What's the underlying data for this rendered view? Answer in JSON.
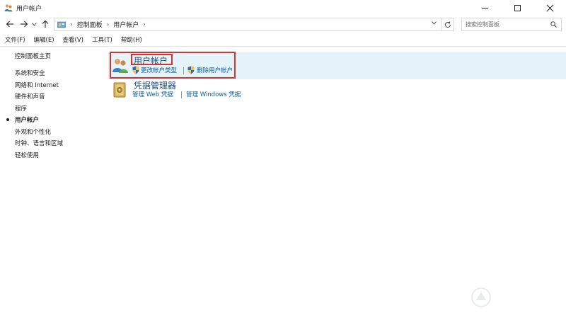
{
  "window": {
    "title": "用户帐户",
    "icon": "users-icon"
  },
  "address": {
    "crumbs": [
      "控制面板",
      "用户帐户"
    ],
    "search_placeholder": "搜索控制面板"
  },
  "menu": {
    "items": [
      "文件(F)",
      "编辑(E)",
      "查看(V)",
      "工具(T)",
      "帮助(H)"
    ]
  },
  "sidebar": {
    "home": "控制面板主页",
    "items": [
      {
        "label": "系统和安全",
        "active": false
      },
      {
        "label": "网络和 Internet",
        "active": false
      },
      {
        "label": "硬件和声音",
        "active": false
      },
      {
        "label": "程序",
        "active": false
      },
      {
        "label": "用户帐户",
        "active": true
      },
      {
        "label": "外观和个性化",
        "active": false
      },
      {
        "label": "时钟、语言和区域",
        "active": false
      },
      {
        "label": "轻松使用",
        "active": false
      }
    ]
  },
  "categories": [
    {
      "title": "用户帐户",
      "icon": "users-icon",
      "links": [
        "更改帐户类型",
        "删除用户帐户"
      ]
    },
    {
      "title": "凭据管理器",
      "icon": "credential-vault-icon",
      "links": [
        "管理 Web 凭据",
        "管理 Windows 凭据"
      ]
    }
  ],
  "colors": {
    "highlight": "#e5f3fb",
    "annotation_red": "#d6332e",
    "link": "#0a5ea8",
    "category_title": "#1e4a7e"
  }
}
